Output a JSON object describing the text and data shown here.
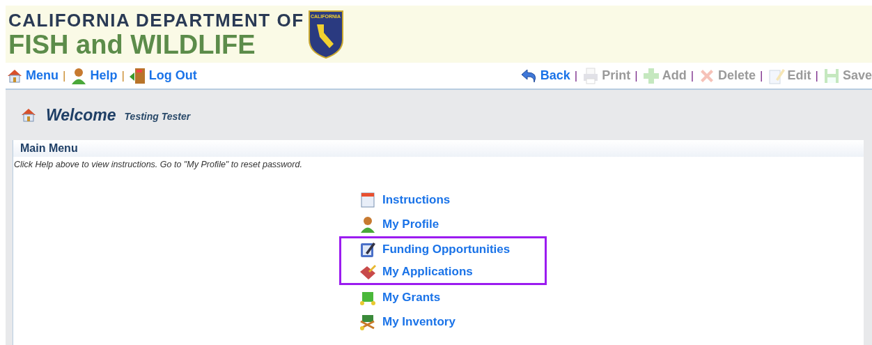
{
  "header": {
    "line_1": "CALIFORNIA DEPARTMENT OF",
    "line_2": "FISH and WILDLIFE",
    "badge_text": "CALIFORNIA"
  },
  "nav_links": [
    {
      "label": "Menu"
    },
    {
      "separator_before": "|",
      "label": "Help"
    },
    {
      "separator_before": "|",
      "label": "Log Out"
    }
  ],
  "toolbar": [
    {
      "label": "Back",
      "disabled": false
    },
    {
      "separator_before": "|",
      "label": "Print",
      "disabled": true
    },
    {
      "separator_before": "|",
      "label": "Add",
      "disabled": true
    },
    {
      "separator_before": "|",
      "label": "Delete",
      "disabled": true
    },
    {
      "separator_before": "|",
      "label": "Edit",
      "disabled": true
    },
    {
      "separator_before": "|",
      "label": "Save",
      "disabled": true
    }
  ],
  "welcome": {
    "title": "Welcome",
    "user": "Testing Tester"
  },
  "panel": {
    "title": "Main Menu",
    "hint": "Click Help above to view instructions. Go to \"My Profile\" to reset password.",
    "items": [
      {
        "label": "Instructions",
        "highlighted": false
      },
      {
        "label": "My Profile",
        "highlighted": false
      },
      {
        "label": "Funding Opportunities",
        "highlighted": true
      },
      {
        "label": "My Applications",
        "highlighted": true
      },
      {
        "label": "My Grants",
        "highlighted": false
      },
      {
        "label": "My Inventory",
        "highlighted": false
      }
    ]
  }
}
